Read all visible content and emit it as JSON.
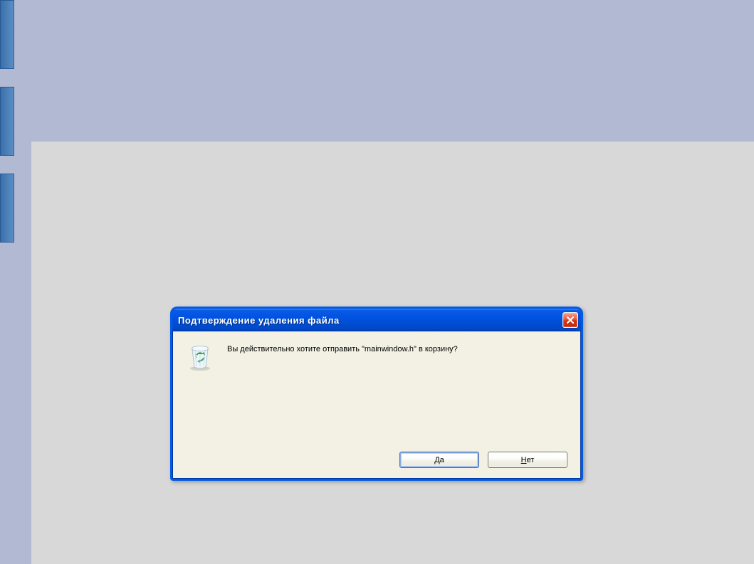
{
  "dialog": {
    "title": "Подтверждение удаления файла",
    "message": "Вы действительно хотите отправить \"mainwindow.h\" в корзину?",
    "yes_label": "Да",
    "yes_mnemonic": "Д",
    "no_label": "Нет",
    "no_mnemonic": "Н"
  }
}
